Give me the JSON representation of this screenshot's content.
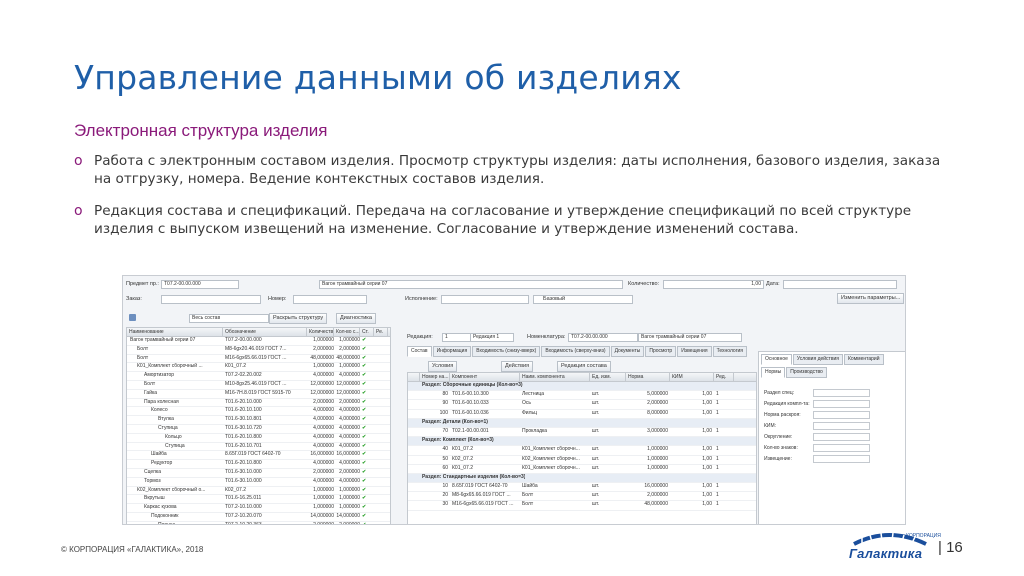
{
  "slide": {
    "title": "Управление данными об изделиях",
    "subtitle": "Электронная структура изделия",
    "bullets": [
      {
        "marker": "o",
        "text": "Работа с электронным составом изделия. Просмотр структуры изделия: даты исполнения, базового изделия, заказа на отгрузку, номера. Ведение контекстных составов изделия."
      },
      {
        "marker": "o",
        "text": "Редакция состава и спецификаций. Передача на согласование и утверждение спецификаций по всей структуре изделия с выпуском извещений на изменение. Согласование и утверждение изменений состава."
      }
    ],
    "copyright": "© КОРПОРАЦИЯ «ГАЛАКТИКА», 2018",
    "page_number": "| 16",
    "logo_text": "Галактика",
    "logo_small": "КОРПОРАЦИЯ",
    "accent_color": "#1f5fa8",
    "subtitle_color": "#8a1a7a"
  },
  "app": {
    "form": {
      "subject_label": "Предмет пр.:",
      "subject_value": "Т07.2-00.00.000",
      "subject_name": "Вагон трамвайный серии 07",
      "qty_label": "Количество:",
      "qty_value": "1,00",
      "date_label": "Дата:",
      "order_label": "Заказ:",
      "number_label": "Номер:",
      "executor_label": "Исполнение:",
      "base_label": "Базовый",
      "change_params": "Изменить параметры..."
    },
    "toolbar": {
      "scope": "Весь состав",
      "expand": "Раскрыть структуру",
      "diagnostics": "Диагностика"
    },
    "tree": {
      "columns": [
        "Наименование",
        "Обозначение",
        "Количество",
        "Кол-во с...",
        "Ст.",
        "Ре."
      ],
      "rows": [
        {
          "name": "Вагон трамвайный серии 07",
          "code": "Т07.2-00.00.000",
          "qty": "1,000000",
          "qty2": "1,000000",
          "level": 0
        },
        {
          "name": "Болт",
          "code": "М8-6gx20.46.019 ГОСТ 7...",
          "qty": "2,000000",
          "qty2": "2,000000",
          "level": 1
        },
        {
          "name": "Болт",
          "code": "М16-6gx65.66.019 ГОСТ ...",
          "qty": "48,000000",
          "qty2": "48,000000",
          "level": 1
        },
        {
          "name": "К01_Комплект сборочный ...",
          "code": "К01_07.2",
          "qty": "1,000000",
          "qty2": "1,000000",
          "level": 1
        },
        {
          "name": "Амортизатор",
          "code": "Т07.2-02.20.002",
          "qty": "4,000000",
          "qty2": "4,000000",
          "level": 2
        },
        {
          "name": "Болт",
          "code": "М10-8gx25.46.019 ГОСТ ...",
          "qty": "12,000000",
          "qty2": "12,000000",
          "level": 2
        },
        {
          "name": "Гайка",
          "code": "М16-7Н.8.019 ГОСТ 5915-70",
          "qty": "12,000000",
          "qty2": "12,000000",
          "level": 2
        },
        {
          "name": "Пара колесная",
          "code": "Т01.6-20.10.000",
          "qty": "2,000000",
          "qty2": "2,000000",
          "level": 2
        },
        {
          "name": "Колесо",
          "code": "Т01.6-20.10.100",
          "qty": "4,000000",
          "qty2": "4,000000",
          "level": 3
        },
        {
          "name": "Втулка",
          "code": "Т01.6-30.10.801",
          "qty": "4,000000",
          "qty2": "4,000000",
          "level": 4
        },
        {
          "name": "Ступица",
          "code": "Т01.6-30.10.720",
          "qty": "4,000000",
          "qty2": "4,000000",
          "level": 4
        },
        {
          "name": "Кольцо",
          "code": "Т01.6-20.10.800",
          "qty": "4,000000",
          "qty2": "4,000000",
          "level": 5
        },
        {
          "name": "Ступица",
          "code": "Т01.6-20.10.701",
          "qty": "4,000000",
          "qty2": "4,000000",
          "level": 5
        },
        {
          "name": "Шайба",
          "code": "8.65Г.019 ГОСТ 6402-70",
          "qty": "16,000000",
          "qty2": "16,000000",
          "level": 3
        },
        {
          "name": "Редуктор",
          "code": "Т01.6-20.10.800",
          "qty": "4,000000",
          "qty2": "4,000000",
          "level": 3
        },
        {
          "name": "Сцепка",
          "code": "Т01.6-30.10.000",
          "qty": "2,000000",
          "qty2": "2,000000",
          "level": 2
        },
        {
          "name": "Тормоз",
          "code": "Т01.6-30.10.000",
          "qty": "4,000000",
          "qty2": "4,000000",
          "level": 2
        },
        {
          "name": "К02_Комплект сборочный о...",
          "code": "К02_07.2",
          "qty": "1,000000",
          "qty2": "1,000000",
          "level": 1
        },
        {
          "name": "Вкрутыш",
          "code": "Т01.6-16.25.011",
          "qty": "1,000000",
          "qty2": "1,000000",
          "level": 2
        },
        {
          "name": "Каркас кузова",
          "code": "Т07.2-10.10.000",
          "qty": "1,000000",
          "qty2": "1,000000",
          "level": 2
        },
        {
          "name": "Подоконник",
          "code": "Т07.2-10.20.070",
          "qty": "14,000000",
          "qty2": "14,000000",
          "level": 3
        },
        {
          "name": "Планка",
          "code": "Т07.2-10.20.363",
          "qty": "2,000000",
          "qty2": "2,000000",
          "level": 4
        }
      ]
    },
    "right": {
      "revision_label": "Редакция:",
      "revision_value": "1",
      "revision_name": "Редакция 1",
      "nomenclature_label": "Номенклатура:",
      "nomenclature_value": "Т07.2-00.00.000",
      "nomenclature_name": "Вагон трамвайный серии 07",
      "tabs": [
        "Состав",
        "Информация",
        "Входимость (снизу-вверх)",
        "Входимость (сверху-вниз)",
        "Документы",
        "Просмотр",
        "Извещения",
        "Технология"
      ],
      "toolbar": {
        "conditions": "Условия",
        "actions": "Действия",
        "revision_state": "Редакция состава"
      },
      "grid_columns": [
        "",
        "Номер на...",
        "Компонент",
        "Наим. компонента",
        "Ед. изм.",
        "Норма",
        "КИМ",
        "Ред."
      ],
      "grid_rows": [
        {
          "type": "section",
          "text": "Раздел: Сборочные единицы (Кол-во=3)"
        },
        {
          "num": "80",
          "code": "Т01.6-00.10.300",
          "name": "Лестница",
          "unit": "шт.",
          "norm": "5,000000",
          "kim": "1,00",
          "red": "1"
        },
        {
          "num": "90",
          "code": "Т01.6-00.10.033",
          "name": "Ось",
          "unit": "шт.",
          "norm": "2,000000",
          "kim": "1,00",
          "red": "1"
        },
        {
          "num": "100",
          "code": "Т01.6-00.10.036",
          "name": "Фильц",
          "unit": "шт.",
          "norm": "8,000000",
          "kim": "1,00",
          "red": "1"
        },
        {
          "type": "section",
          "text": "Раздел: Детали (Кол-во=1)"
        },
        {
          "num": "70",
          "code": "Т02.1-00.00.001",
          "name": "Прокладка",
          "unit": "шт.",
          "norm": "3,000000",
          "kim": "1,00",
          "red": "1"
        },
        {
          "type": "section",
          "text": "Раздел: Комплект (Кол-во=3)"
        },
        {
          "num": "40",
          "code": "К01_07.2",
          "name": "К01_Комплект сборочн...",
          "unit": "шт.",
          "norm": "1,000000",
          "kim": "1,00",
          "red": "1"
        },
        {
          "num": "50",
          "code": "К02_07.2",
          "name": "К02_Комплект сборочн...",
          "unit": "шт.",
          "norm": "1,000000",
          "kim": "1,00",
          "red": "1"
        },
        {
          "num": "60",
          "code": "К01_07.2",
          "name": "К01_Комплект сборочн...",
          "unit": "шт.",
          "norm": "1,000000",
          "kim": "1,00",
          "red": "1"
        },
        {
          "type": "section",
          "text": "Раздел: Стандартные изделия (Кол-во=3)"
        },
        {
          "num": "10",
          "code": "8.65Г.019 ГОСТ 6402-70",
          "name": "Шайба",
          "unit": "шт.",
          "norm": "16,000000",
          "kim": "1,00",
          "red": "1"
        },
        {
          "num": "20",
          "code": "М8-6gx65.66.019 ГОСТ ...",
          "name": "Болт",
          "unit": "шт.",
          "norm": "2,000000",
          "kim": "1,00",
          "red": "1"
        },
        {
          "num": "30",
          "code": "М16-6gx65.66.019 ГОСТ ...",
          "name": "Болт",
          "unit": "шт.",
          "norm": "48,000000",
          "kim": "1,00",
          "red": "1"
        }
      ],
      "props_tabs": [
        "Основное",
        "Условия действия",
        "Комментарий"
      ],
      "props_subtabs": [
        "Нормы",
        "Производство"
      ],
      "props_fields": [
        "Раздел спец:",
        "Редакция компл-та:",
        "Норма раскроя:",
        "КИМ:",
        "Округление:",
        "Кол-во знаков:",
        "Извещение:"
      ]
    }
  }
}
